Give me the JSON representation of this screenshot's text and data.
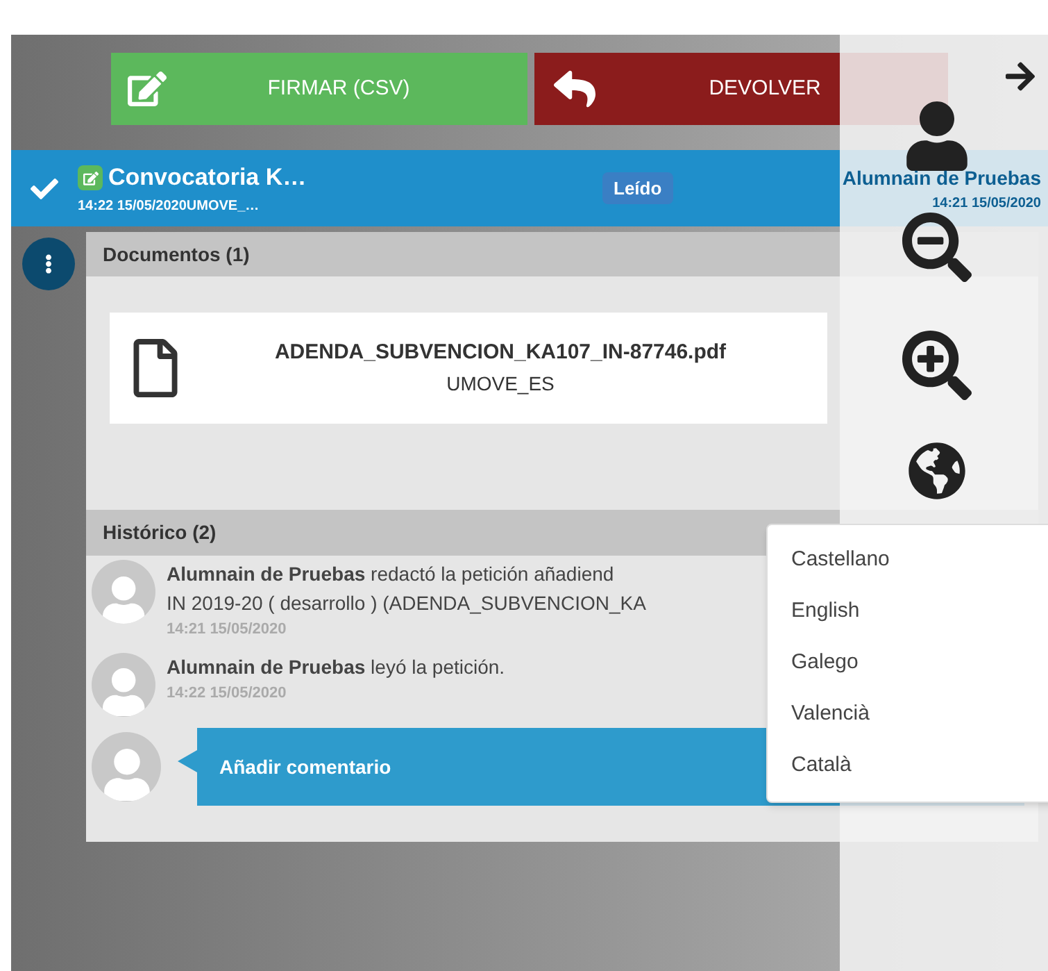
{
  "toolbar": {
    "buttons": [
      {
        "label": "FIRMAR (CSV)",
        "kind": "sign"
      },
      {
        "label": "DEVOLVER",
        "kind": "return"
      }
    ]
  },
  "request": {
    "checked": true,
    "title": "Convocatoria K…",
    "subtitle": "14:22 15/05/2020UMOVE_…",
    "status": "Leído",
    "author": "Alumnain de Pruebas",
    "date": "14:21 15/05/2020"
  },
  "documents": {
    "title": "Documentos (1)",
    "items": [
      {
        "name": "ADENDA_SUBVENCION_KA107_IN-87746.pdf",
        "owner": "UMOVE_ES"
      }
    ]
  },
  "history": {
    "title": "Histórico (2)",
    "entries": [
      {
        "lines": [
          "**Alumnain de Pruebas** redactó la petición añadiend",
          "IN 2019-20 ( desarrollo ) (ADENDA_SUBVENCION_KA"
        ],
        "time": "14:21 15/05/2020"
      },
      {
        "lines": [
          "**Alumnain de Pruebas** leyó la petición."
        ],
        "time": "14:22 15/05/2020"
      }
    ]
  },
  "comment": {
    "placeholder": "Añadir comentario"
  },
  "language_menu": {
    "items": [
      "Castellano",
      "English",
      "Galego",
      "Valencià",
      "Català"
    ]
  }
}
